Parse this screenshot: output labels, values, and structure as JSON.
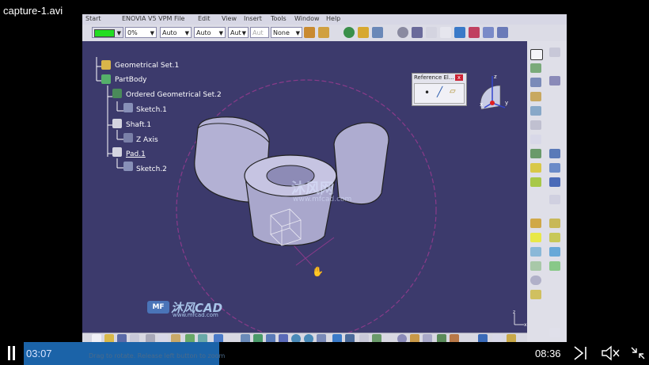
{
  "player": {
    "title": "capture-1.avi",
    "time_current": "03:07",
    "time_total": "08:36",
    "progress_fraction": 0.36
  },
  "app": {
    "menu": [
      "Start",
      "ENOVIA V5 VPM",
      "File",
      "Edit",
      "View",
      "Insert",
      "Tools",
      "Window",
      "Help"
    ],
    "toolbar": {
      "color_swatch": "#22dd22",
      "transparency": "0%",
      "line_weight": "Auto",
      "line_type": "Auto",
      "point_type": "Aut",
      "layer_1": "Aut",
      "layer_2": "None"
    },
    "status_text": "Drag to rotate. Release left button to zoom"
  },
  "tree": {
    "items": [
      {
        "label": "Geometrical Set.1"
      },
      {
        "label": "PartBody"
      },
      {
        "label": "Ordered Geometrical Set.2"
      },
      {
        "label": "Sketch.1"
      },
      {
        "label": "Shaft.1"
      },
      {
        "label": "Z Axis"
      },
      {
        "label": "Pad.1"
      },
      {
        "label": "Sketch.2"
      }
    ]
  },
  "ref_panel": {
    "title": "Reference El...",
    "close": "x"
  },
  "compass": {
    "x": "x",
    "y": "y",
    "z": "z"
  },
  "axis_indicator": {
    "z": "z",
    "x": "x"
  },
  "watermarks": {
    "center_text": "沐风网",
    "center_url": "www.mfcad.com",
    "logo_text": "沐风CAD",
    "logo_url": "www.mfcad.com",
    "logo_mark": "MF"
  },
  "colors": {
    "canvas_bg": "#3c3a6c",
    "progress": "#1b63a8",
    "part_surface": "#b8b6d8",
    "circle_dash": "#8a3a8a"
  }
}
